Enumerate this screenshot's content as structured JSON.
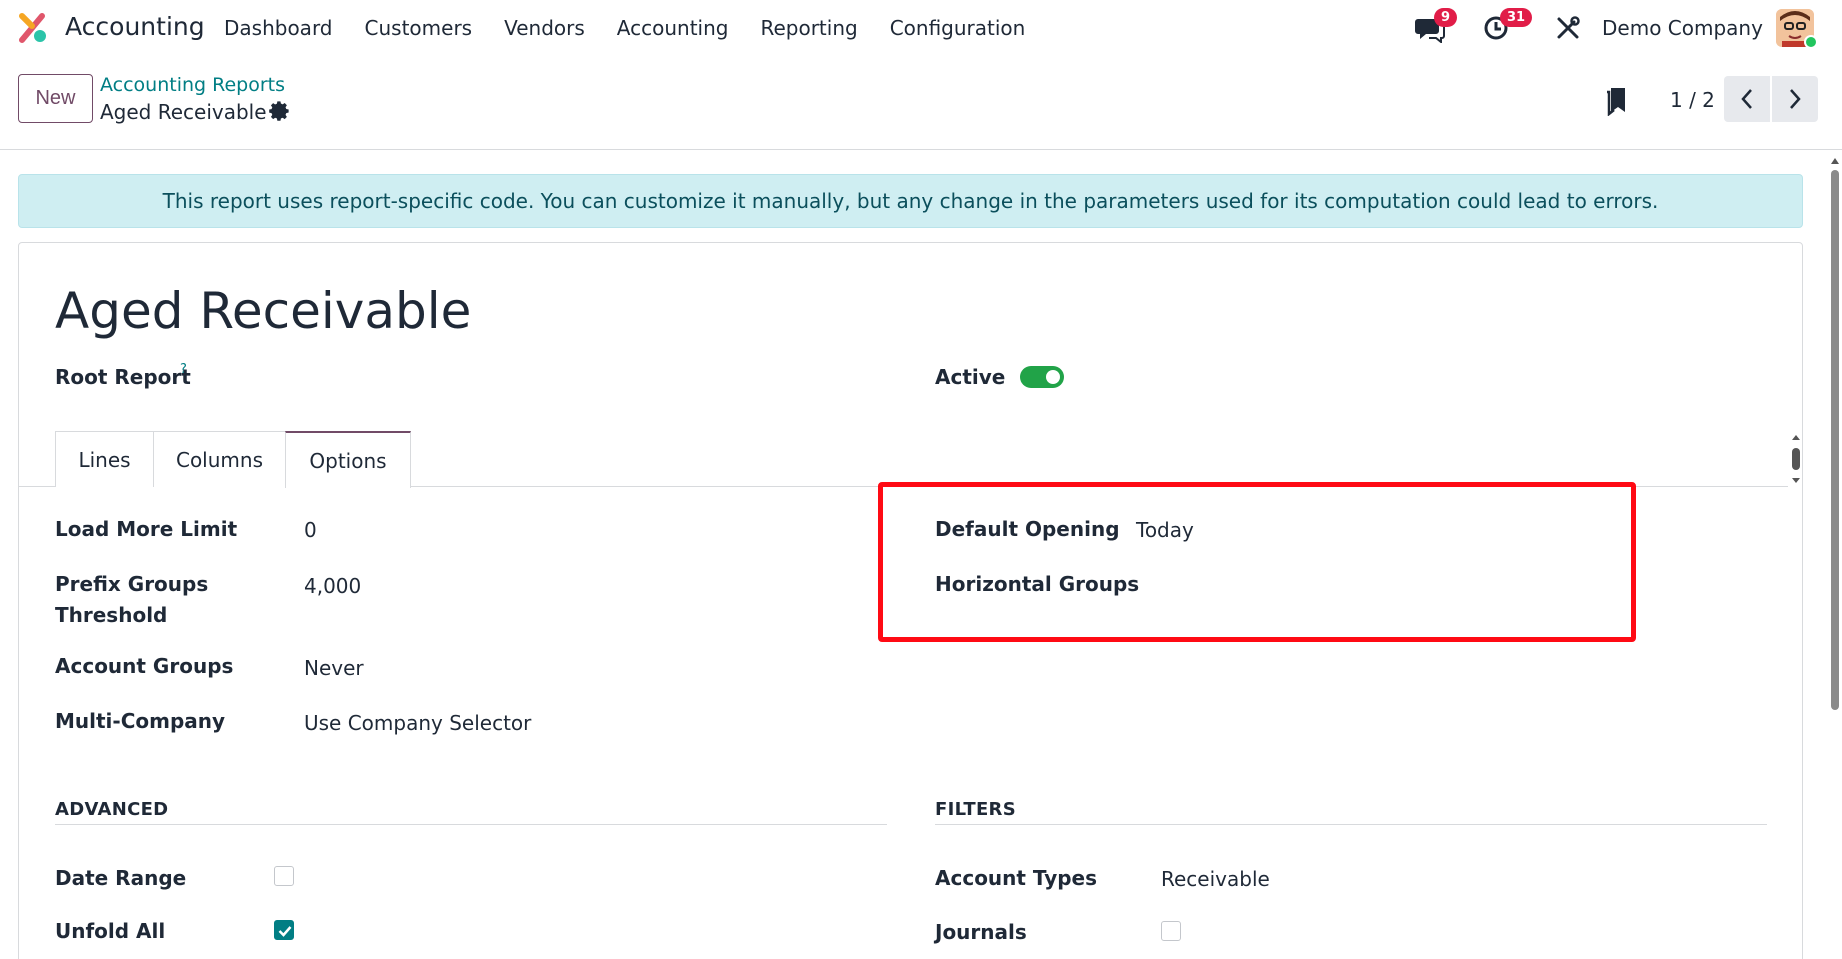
{
  "navbar": {
    "app_name": "Accounting",
    "menu": [
      "Dashboard",
      "Customers",
      "Vendors",
      "Accounting",
      "Reporting",
      "Configuration"
    ],
    "chat_count": "9",
    "activity_count": "31",
    "company": "Demo Company"
  },
  "control": {
    "new_label": "New",
    "breadcrumb_parent": "Accounting Reports",
    "breadcrumb_current": "Aged Receivable",
    "pager": "1 / 2"
  },
  "alert": "This report uses report-specific code. You can customize it manually, but any change in the parameters used for its computation could lead to errors.",
  "form": {
    "title": "Aged Receivable",
    "root_report_label": "Root Report",
    "help_mark": "?",
    "active_label": "Active",
    "active": true,
    "tabs": [
      "Lines",
      "Columns",
      "Options"
    ],
    "active_tab": "Options",
    "options": {
      "load_more_limit_label": "Load More Limit",
      "load_more_limit": "0",
      "prefix_groups_label_1": "Prefix Groups",
      "prefix_groups_label_2": "Threshold",
      "prefix_groups": "4,000",
      "account_groups_label": "Account Groups",
      "account_groups": "Never",
      "multi_company_label": "Multi-Company",
      "multi_company": "Use Company Selector",
      "default_opening_label": "Default Opening",
      "default_opening": "Today",
      "horizontal_groups_label": "Horizontal Groups"
    },
    "advanced": {
      "heading": "ADVANCED",
      "date_range_label": "Date Range",
      "date_range": false,
      "unfold_all_label": "Unfold All",
      "unfold_all": true
    },
    "filters": {
      "heading": "FILTERS",
      "account_types_label": "Account Types",
      "account_types": "Receivable",
      "journals_label": "Journals",
      "journals": false
    }
  },
  "colors": {
    "brand": "#714B67",
    "link": "#017e84",
    "highlight_box": "#ff0a14",
    "toggle_on": "#21a348"
  }
}
